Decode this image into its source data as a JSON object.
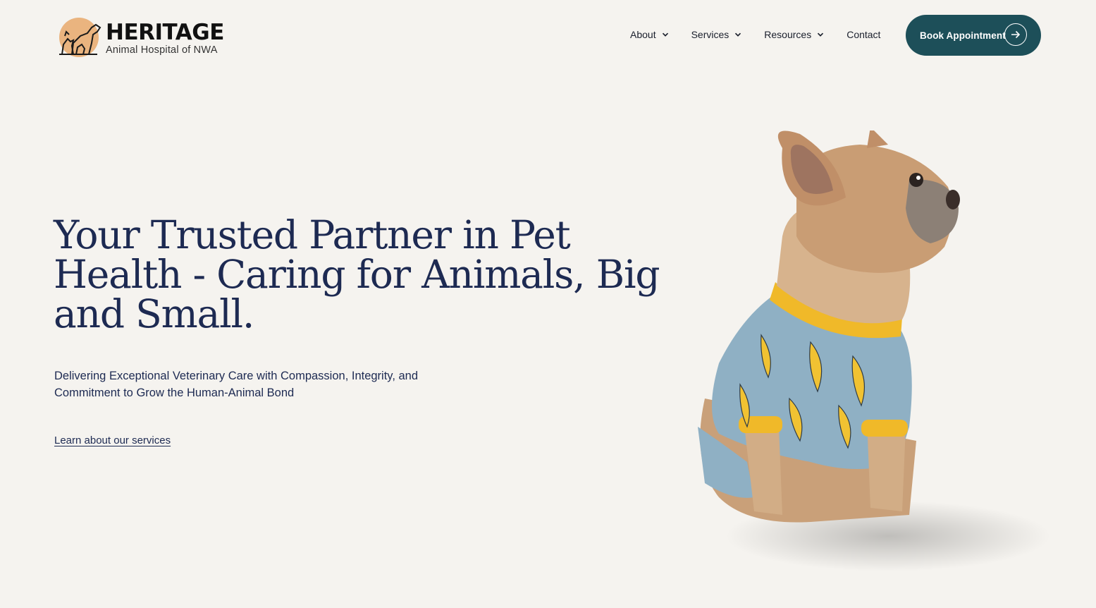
{
  "brand": {
    "name": "HERITAGE",
    "tagline": "Animal Hospital of NWA",
    "colors": {
      "primary": "#1d4f59",
      "text": "#1d2a52",
      "background": "#f5f3ef",
      "logo_accent": "#e8a86b"
    }
  },
  "nav": {
    "items": [
      {
        "label": "About",
        "has_dropdown": true
      },
      {
        "label": "Services",
        "has_dropdown": true
      },
      {
        "label": "Resources",
        "has_dropdown": true
      },
      {
        "label": "Contact",
        "has_dropdown": false
      }
    ],
    "cta": {
      "label": "Book Appointment",
      "icon": "arrow-right-icon"
    }
  },
  "hero": {
    "title": "Your Trusted Partner in Pet Health - Caring for Animals, Big and Small.",
    "subtitle": "Delivering Exceptional Veterinary Care with Compassion, Integrity, and Commitment to Grow the Human-Animal Bond",
    "link_label": "Learn about our services"
  }
}
